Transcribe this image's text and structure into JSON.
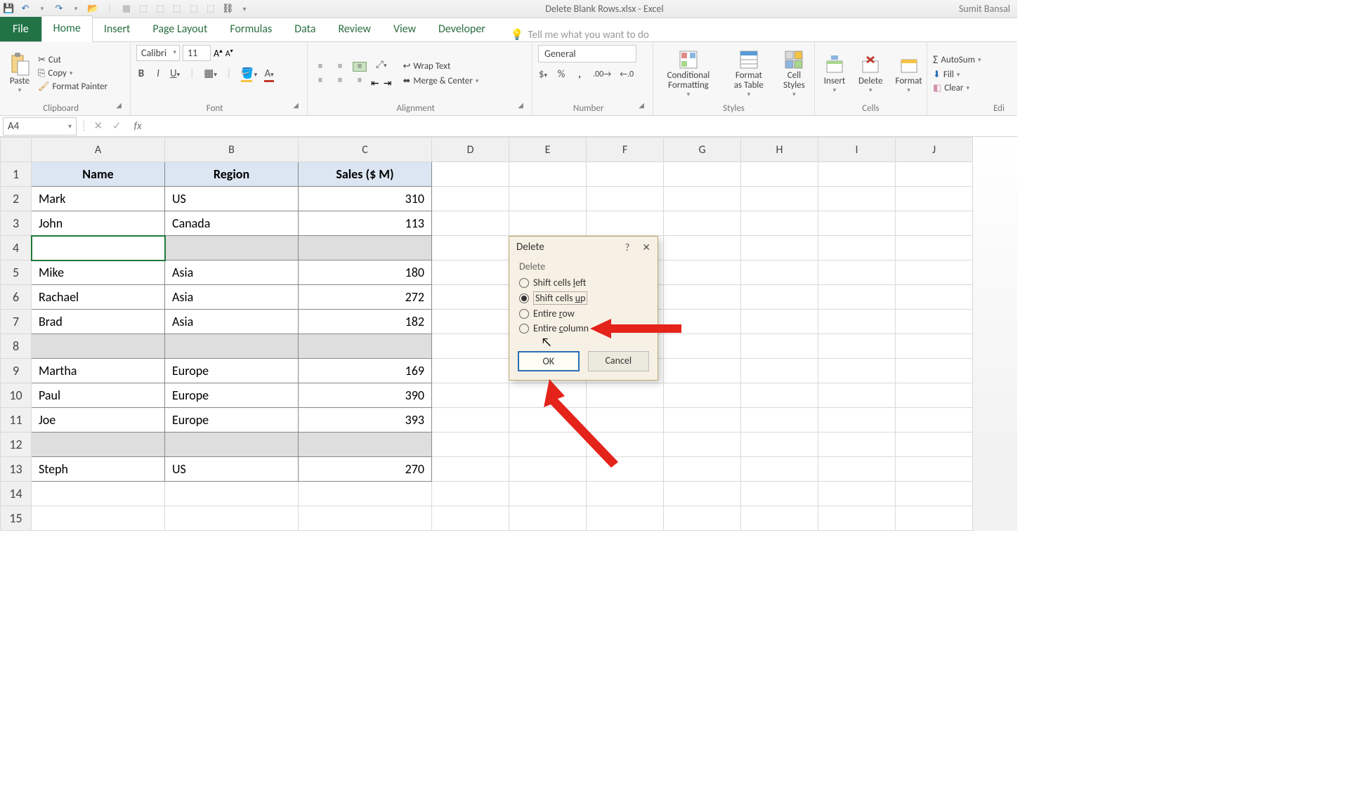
{
  "titlebar": {
    "doc_title": "Delete Blank Rows.xlsx - Excel",
    "user": "Sumit Bansal"
  },
  "tabs": {
    "file": "File",
    "items": [
      "Home",
      "Insert",
      "Page Layout",
      "Formulas",
      "Data",
      "Review",
      "View",
      "Developer"
    ],
    "active": "Home",
    "tellme": "Tell me what you want to do"
  },
  "ribbon": {
    "clipboard": {
      "label": "Clipboard",
      "paste": "Paste",
      "cut": "Cut",
      "copy": "Copy",
      "painter": "Format Painter"
    },
    "font": {
      "label": "Font",
      "name": "Calibri",
      "size": "11"
    },
    "alignment": {
      "label": "Alignment",
      "wrap": "Wrap Text",
      "merge": "Merge & Center"
    },
    "number": {
      "label": "Number",
      "format": "General"
    },
    "styles": {
      "label": "Styles",
      "cond": "Conditional Formatting",
      "tbl": "Format as Table",
      "cell": "Cell Styles"
    },
    "cells": {
      "label": "Cells",
      "insert": "Insert",
      "delete": "Delete",
      "format": "Format"
    },
    "editing": {
      "label": "Edi",
      "autosum": "AutoSum",
      "fill": "Fill",
      "clear": "Clear"
    }
  },
  "formula_bar": {
    "namebox": "A4",
    "fx": ""
  },
  "sheet": {
    "columns": [
      "A",
      "B",
      "C",
      "D",
      "E",
      "F",
      "G",
      "H",
      "I",
      "J"
    ],
    "headers": [
      "Name",
      "Region",
      "Sales ($ M)"
    ],
    "rows": [
      {
        "n": 1,
        "header": true
      },
      {
        "n": 2,
        "name": "Mark",
        "region": "US",
        "sales": "310"
      },
      {
        "n": 3,
        "name": "John",
        "region": "Canada",
        "sales": "113"
      },
      {
        "n": 4,
        "blank": true,
        "selected": true,
        "active": true
      },
      {
        "n": 5,
        "name": "Mike",
        "region": "Asia",
        "sales": "180"
      },
      {
        "n": 6,
        "name": "Rachael",
        "region": "Asia",
        "sales": "272"
      },
      {
        "n": 7,
        "name": "Brad",
        "region": "Asia",
        "sales": "182"
      },
      {
        "n": 8,
        "blank": true,
        "selected": true
      },
      {
        "n": 9,
        "name": "Martha",
        "region": "Europe",
        "sales": "169"
      },
      {
        "n": 10,
        "name": "Paul",
        "region": "Europe",
        "sales": "390"
      },
      {
        "n": 11,
        "name": "Joe",
        "region": "Europe",
        "sales": "393"
      },
      {
        "n": 12,
        "blank": true,
        "selected": true
      },
      {
        "n": 13,
        "name": "Steph",
        "region": "US",
        "sales": "270"
      },
      {
        "n": 14,
        "empty": true
      },
      {
        "n": 15,
        "empty": true
      }
    ]
  },
  "dialog": {
    "title": "Delete",
    "section": "Delete",
    "options": {
      "shift_left": "Shift cells left",
      "shift_up": "Shift cells up",
      "entire_row": "Entire row",
      "entire_col": "Entire column"
    },
    "selected": "shift_up",
    "ok": "OK",
    "cancel": "Cancel"
  }
}
